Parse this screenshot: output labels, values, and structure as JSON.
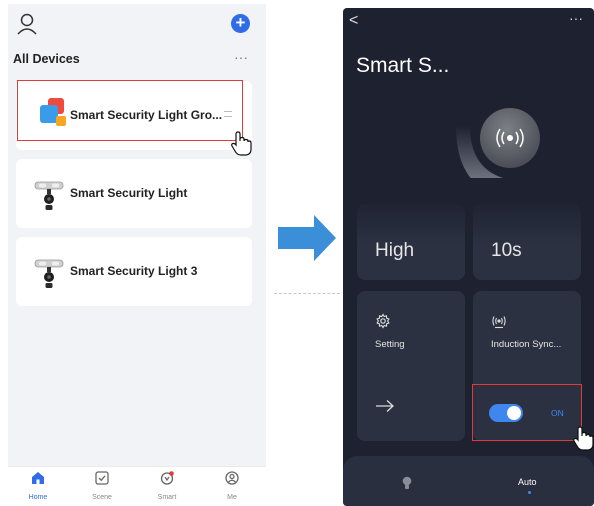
{
  "left": {
    "title": "All Devices",
    "more": "···",
    "add": "+",
    "devices": [
      {
        "name": "Smart Security Light Gro...",
        "icon": "device-group-icon"
      },
      {
        "name": "Smart Security Light",
        "icon": "security-light-icon"
      },
      {
        "name": "Smart Security Light 3",
        "icon": "security-light-icon"
      }
    ],
    "nav": [
      {
        "label": "Home",
        "icon": "home-icon"
      },
      {
        "label": "Scene",
        "icon": "scene-icon"
      },
      {
        "label": "Smart",
        "icon": "smart-icon"
      },
      {
        "label": "Me",
        "icon": "me-icon"
      }
    ]
  },
  "right": {
    "back": "<",
    "more": "···",
    "title": "Smart S...",
    "sensitivity": "High",
    "duration": "10s",
    "setting_label": "Setting",
    "induction_label": "Induction Sync...",
    "induction_state": "ON",
    "tabs": [
      {
        "label": "",
        "icon": "bulb-icon"
      },
      {
        "label": "Auto"
      }
    ]
  },
  "colors": {
    "accent": "#2f6ce6",
    "highlight": "#e03b3b",
    "arrow": "#3a8fd8",
    "dark_bg": "#1d2130",
    "tile_bg": "#2c3142"
  }
}
